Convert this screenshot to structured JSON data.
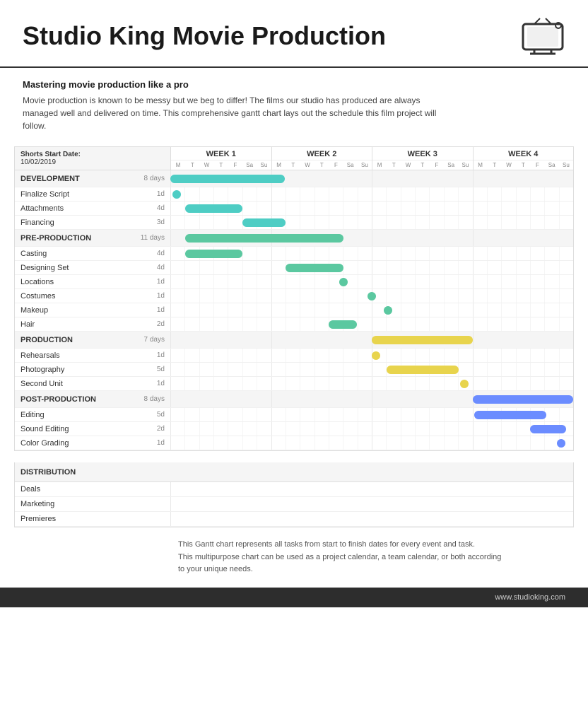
{
  "header": {
    "title": "Studio King Movie Production",
    "start_date_label": "Shorts Start Date:",
    "start_date_value": "10/02/2019"
  },
  "subtitle": {
    "heading": "Mastering movie production like a pro",
    "text": "Movie production is known to be messy but we beg to differ! The films our studio has produced are always managed well and delivered on time. This comprehensive gantt chart lays out the schedule this film project will follow."
  },
  "weeks": [
    "WEEK 1",
    "WEEK 2",
    "WEEK 3",
    "WEEK 4"
  ],
  "days": [
    "M",
    "T",
    "W",
    "T",
    "F",
    "Sa",
    "Su"
  ],
  "sections": [
    {
      "id": "development",
      "label": "DEVELOPMENT",
      "duration": "8 days",
      "tasks": [
        {
          "label": "Finalize Script",
          "duration": "1d"
        },
        {
          "label": "Attachments",
          "duration": "4d"
        },
        {
          "label": "Financing",
          "duration": "3d"
        }
      ]
    },
    {
      "id": "pre-production",
      "label": "PRE-PRODUCTION",
      "duration": "11 days",
      "tasks": [
        {
          "label": "Casting",
          "duration": "4d"
        },
        {
          "label": "Designing Set",
          "duration": "4d"
        },
        {
          "label": "Locations",
          "duration": "1d"
        },
        {
          "label": "Costumes",
          "duration": "1d"
        },
        {
          "label": "Makeup",
          "duration": "1d"
        },
        {
          "label": "Hair",
          "duration": "2d"
        }
      ]
    },
    {
      "id": "production",
      "label": "PRODUCTION",
      "duration": "7 days",
      "tasks": [
        {
          "label": "Rehearsals",
          "duration": "1d"
        },
        {
          "label": "Photography",
          "duration": "5d"
        },
        {
          "label": "Second Unit",
          "duration": "1d"
        }
      ]
    },
    {
      "id": "post-production",
      "label": "POST-PRODUCTION",
      "duration": "8 days",
      "tasks": [
        {
          "label": "Editing",
          "duration": "5d"
        },
        {
          "label": "Sound Editing",
          "duration": "2d"
        },
        {
          "label": "Color Grading",
          "duration": "1d"
        }
      ]
    }
  ],
  "distribution": {
    "label": "DISTRIBUTION",
    "tasks": [
      "Deals",
      "Marketing",
      "Premieres"
    ]
  },
  "footer_note": "This Gantt chart represents all tasks from start to finish dates for every event and task.\nThis multipurpose chart can be used as a project calendar, a team calendar, or both according\nto your unique needs.",
  "website": "www.studioking.com",
  "colors": {
    "teal": "#4ECDC4",
    "yellow": "#E8D44D",
    "blue": "#6B8CFF",
    "green": "#5BC8A0"
  }
}
